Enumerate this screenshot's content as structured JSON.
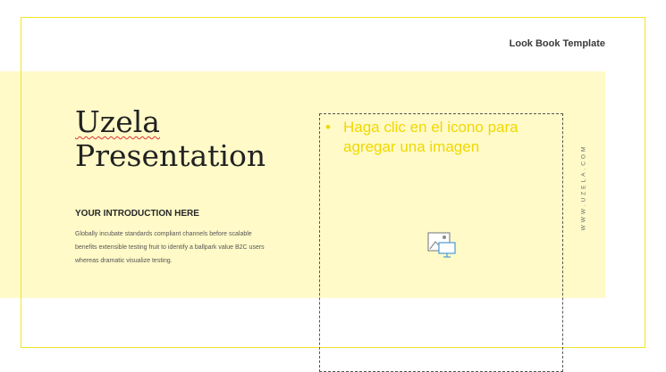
{
  "header": {
    "template_label": "Look Book Template"
  },
  "slide": {
    "title_line1": "Uzela",
    "title_line2": "Presentation",
    "intro_heading": "YOUR INTRODUCTION HERE",
    "body_text": "Globally incubate standards compliant channels before scalable benefits extensible testing fruit to identify a ballpark value B2C users whereas dramatic visualize testing.",
    "vertical_text": "WWW.UZELA.COM"
  },
  "placeholder": {
    "bullet": "•",
    "text": "Haga clic en el icono para agregar una imagen",
    "icon": "insert-picture-icon"
  },
  "colors": {
    "accent_yellow": "#f2e52a",
    "band_fill": "#fffac8",
    "placeholder_text": "#f0d800"
  }
}
